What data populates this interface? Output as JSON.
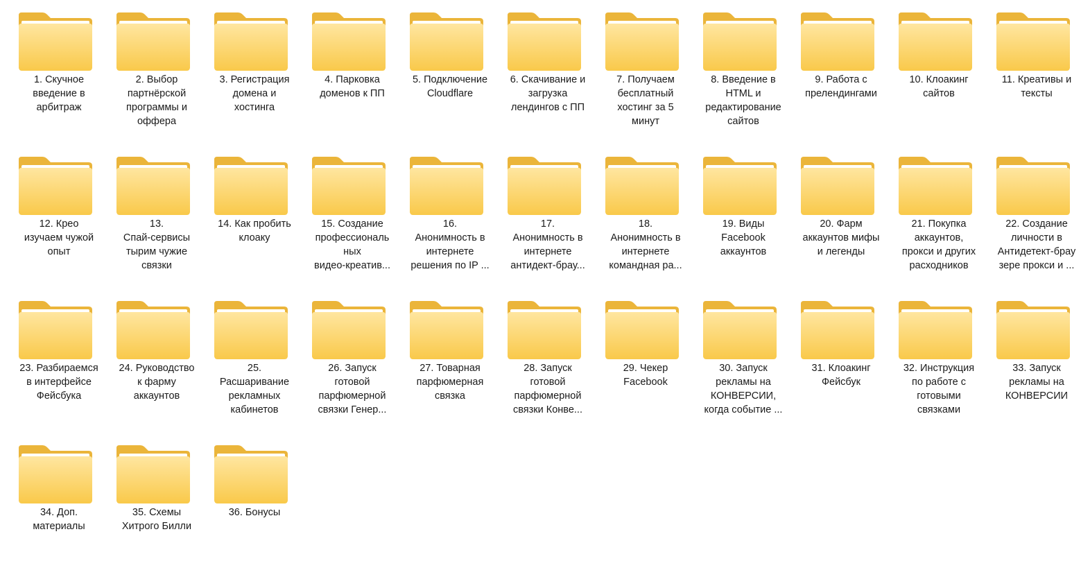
{
  "folder_icon": "folder-icon",
  "colors": {
    "folder_back": "#EBB53A",
    "folder_front_top": "#FFE6A0",
    "folder_front_bottom": "#F9C94A",
    "paper": "#FFFFFF",
    "text": "#1A1A1A"
  },
  "folders": [
    {
      "label": "1. Скучное\nвведение в\nарбитраж"
    },
    {
      "label": "2. Выбор\nпартнёрской\nпрограммы и\nоффера"
    },
    {
      "label": "3. Регистрация\nдомена и\nхостинга"
    },
    {
      "label": "4. Парковка\nдоменов к ПП"
    },
    {
      "label": "5. Подключение\nCloudflare"
    },
    {
      "label": "6. Скачивание и\nзагрузка\nлендингов с ПП"
    },
    {
      "label": "7. Получаем\nбесплатный\nхостинг за 5\nминут"
    },
    {
      "label": "8. Введение в\nHTML и\nредактирование\nсайтов"
    },
    {
      "label": "9. Работа с\nпрелендингами"
    },
    {
      "label": "10. Клоакинг\nсайтов"
    },
    {
      "label": "11. Креативы и\nтексты"
    },
    {
      "label": "12. Крео\nизучаем чужой\nопыт"
    },
    {
      "label": "13.\nСпай-сервисы\nтырим чужие\nсвязки"
    },
    {
      "label": "14. Как пробить\nклоаку"
    },
    {
      "label": "15. Создание\nпрофессиональ\nных\nвидео-креатив..."
    },
    {
      "label": "16.\nАнонимность в\nинтернете\nрешения по IP ..."
    },
    {
      "label": "17.\nАнонимность в\nинтернете\nантидект-брау..."
    },
    {
      "label": "18.\nАнонимность в\nинтернете\nкомандная ра..."
    },
    {
      "label": "19. Виды\nFacebook\nаккаунтов"
    },
    {
      "label": "20. Фарм\nаккаунтов мифы\nи легенды"
    },
    {
      "label": "21. Покупка\nаккаунтов,\nпрокси и других\nрасходников"
    },
    {
      "label": "22. Создание\nличности в\nАнтидетект-брау\nзере прокси и ..."
    },
    {
      "label": "23. Разбираемся\nв интерфейсе\nФейсбука"
    },
    {
      "label": "24. Руководство\nк фарму\nаккаунтов"
    },
    {
      "label": "25.\nРасшаривание\nрекламных\nкабинетов"
    },
    {
      "label": "26. Запуск\nготовой\nпарфюмерной\nсвязки Генер..."
    },
    {
      "label": "27. Товарная\nпарфюмерная\nсвязка"
    },
    {
      "label": "28. Запуск\nготовой\nпарфюмерной\nсвязки Конве..."
    },
    {
      "label": "29. Чекер\nFacebook"
    },
    {
      "label": "30. Запуск\nрекламы на\nКОНВЕРСИИ,\nкогда событие ..."
    },
    {
      "label": "31. Клоакинг\nФейсбук"
    },
    {
      "label": "32. Инструкция\nпо работе с\nготовыми\nсвязками"
    },
    {
      "label": "33. Запуск\nрекламы на\nКОНВЕРСИИ"
    },
    {
      "label": "34. Доп.\nматериалы"
    },
    {
      "label": "35. Схемы\nХитрого Билли"
    },
    {
      "label": "36. Бонусы"
    }
  ]
}
